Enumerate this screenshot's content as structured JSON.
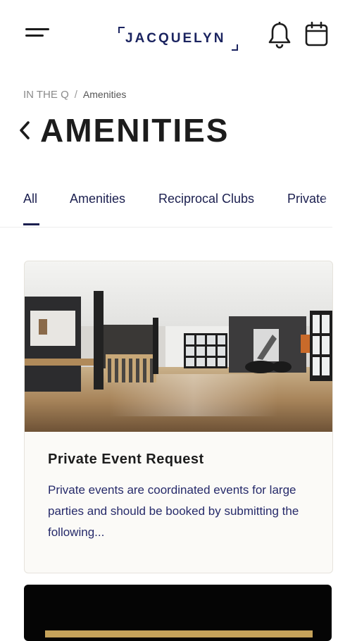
{
  "header": {
    "logo_text": "JACQUELYN",
    "icons": {
      "menu": "hamburger-menu-icon",
      "notifications": "bell-icon",
      "calendar": "calendar-icon"
    }
  },
  "breadcrumb": {
    "root": "IN THE Q",
    "separator": "/",
    "current": "Amenities"
  },
  "page": {
    "title": "AMENITIES"
  },
  "tabs": [
    {
      "label": "All",
      "active": true
    },
    {
      "label": "Amenities",
      "active": false
    },
    {
      "label": "Reciprocal Clubs",
      "active": false
    },
    {
      "label": "Private",
      "active": false
    }
  ],
  "cards": [
    {
      "title": "Private Event Request",
      "description": "Private events are coordinated events for large parties and should be booked by submitting the following..."
    }
  ],
  "colors": {
    "navy": "#1b1f4f",
    "logo": "#1b2460",
    "gold": "#c5a25a"
  }
}
